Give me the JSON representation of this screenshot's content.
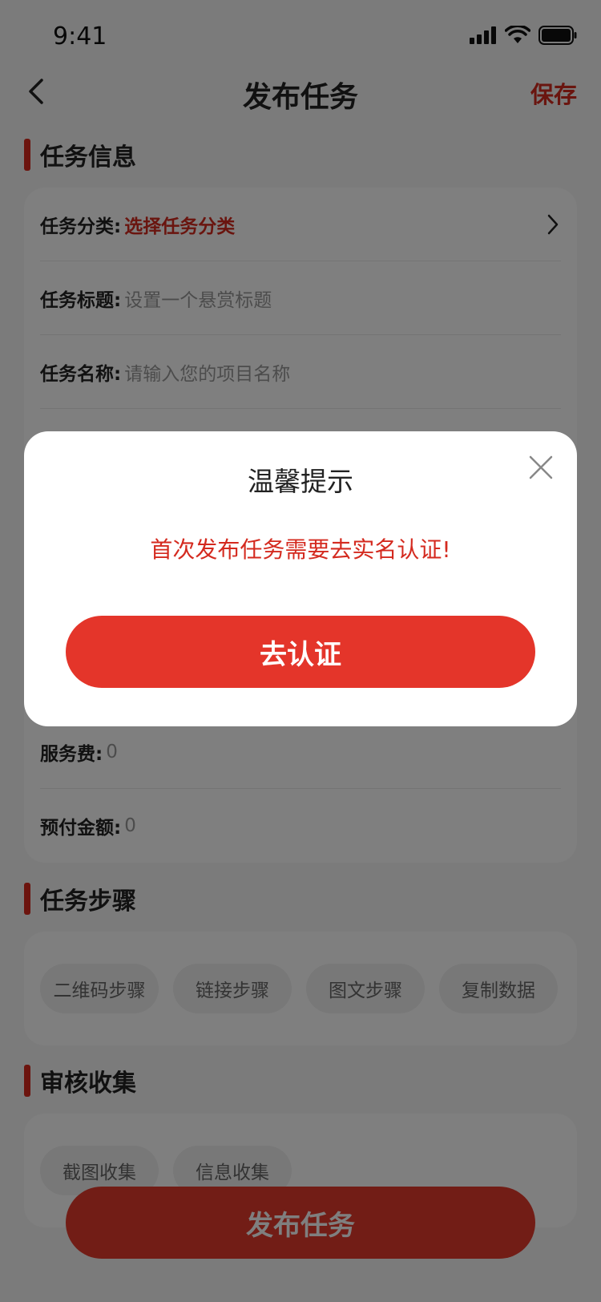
{
  "status_bar": {
    "time": "9:41"
  },
  "nav": {
    "title": "发布任务",
    "save_label": "保存"
  },
  "sections": {
    "task_info": {
      "title": "任务信息"
    },
    "task_steps": {
      "title": "任务步骤"
    },
    "review_collect": {
      "title": "审核收集"
    }
  },
  "task_info_rows": [
    {
      "label": "任务分类:",
      "value": "选择任务分类"
    },
    {
      "label": "任务标题:",
      "placeholder": "设置一个悬赏标题"
    },
    {
      "label": "任务名称:",
      "placeholder": "请输入您的项目名称"
    }
  ],
  "fee_rows": [
    {
      "label": "服务费:",
      "value": "0"
    },
    {
      "label": "预付金额:",
      "value": "0"
    }
  ],
  "step_chips": [
    "二维码步骤",
    "链接步骤",
    "图文步骤",
    "复制数据"
  ],
  "collect_chips": [
    "截图收集",
    "信息收集"
  ],
  "publish_button": "发布任务",
  "dialog": {
    "title": "温馨提示",
    "message": "首次发布任务需要去实名认证!",
    "button": "去认证"
  },
  "colors": {
    "accent": "#d42a1f",
    "button": "#e4352a"
  }
}
